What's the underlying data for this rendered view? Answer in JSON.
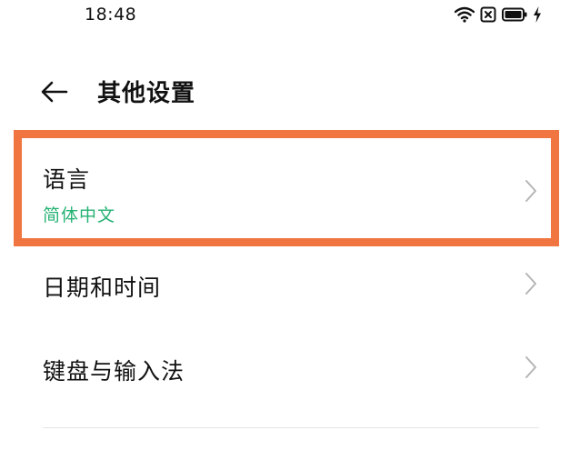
{
  "status_bar": {
    "time": "18:48",
    "icons": [
      "wifi-icon",
      "sim-x-icon",
      "battery-icon",
      "charging-icon"
    ]
  },
  "header": {
    "back_icon": "arrow-left-icon",
    "title": "其他设置"
  },
  "items": [
    {
      "label": "语言",
      "sublabel": "简体中文",
      "icon": "chevron-right-icon",
      "highlighted": true
    },
    {
      "label": "日期和时间",
      "icon": "chevron-right-icon"
    },
    {
      "label": "键盘与输入法",
      "icon": "chevron-right-icon"
    }
  ],
  "colors": {
    "highlight": "#F07541",
    "sublabel": "#27B274",
    "chevron": "#b5b5b5"
  }
}
